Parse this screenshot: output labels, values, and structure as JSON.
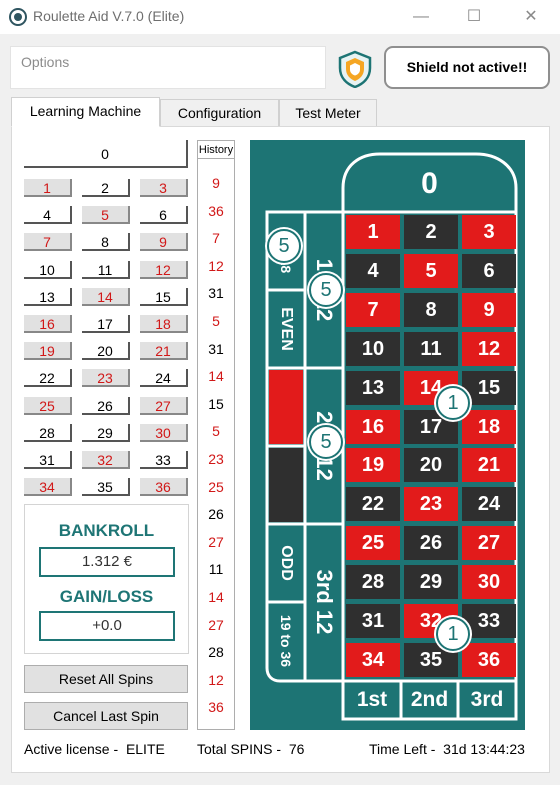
{
  "window": {
    "title": "Roulette Aid V.7.0 (Elite)",
    "minimize": "—",
    "maximize": "☐",
    "close": "✕"
  },
  "options": {
    "placeholder": "Options"
  },
  "shield": {
    "status": "Shield not active!!"
  },
  "tabs": [
    {
      "label": "Learning Machine",
      "active": true
    },
    {
      "label": "Configuration",
      "active": false
    },
    {
      "label": "Test Meter",
      "active": false
    }
  ],
  "number_grid": {
    "zero": "0",
    "rows": [
      [
        "1",
        "2",
        "3"
      ],
      [
        "4",
        "5",
        "6"
      ],
      [
        "7",
        "8",
        "9"
      ],
      [
        "10",
        "11",
        "12"
      ],
      [
        "13",
        "14",
        "15"
      ],
      [
        "16",
        "17",
        "18"
      ],
      [
        "19",
        "20",
        "21"
      ],
      [
        "22",
        "23",
        "24"
      ],
      [
        "25",
        "26",
        "27"
      ],
      [
        "28",
        "29",
        "30"
      ],
      [
        "31",
        "32",
        "33"
      ],
      [
        "34",
        "35",
        "36"
      ]
    ]
  },
  "bankroll": {
    "label": "BANKROLL",
    "value": "1.312 €",
    "gain_loss_label": "GAIN/LOSS",
    "gain_loss_value": "+0.0"
  },
  "buttons": {
    "reset_all": "Reset All Spins",
    "cancel_last": "Cancel Last Spin"
  },
  "history": {
    "title": "History",
    "spins": [
      "9",
      "36",
      "7",
      "12",
      "31",
      "5",
      "31",
      "14",
      "15",
      "5",
      "23",
      "25",
      "26",
      "27",
      "11",
      "14",
      "27",
      "28",
      "12",
      "36"
    ]
  },
  "board": {
    "zero": "0",
    "rows": [
      [
        "1",
        "2",
        "3"
      ],
      [
        "4",
        "5",
        "6"
      ],
      [
        "7",
        "8",
        "9"
      ],
      [
        "10",
        "11",
        "12"
      ],
      [
        "13",
        "14",
        "15"
      ],
      [
        "16",
        "17",
        "18"
      ],
      [
        "19",
        "20",
        "21"
      ],
      [
        "22",
        "23",
        "24"
      ],
      [
        "25",
        "26",
        "27"
      ],
      [
        "28",
        "29",
        "30"
      ],
      [
        "31",
        "32",
        "33"
      ],
      [
        "34",
        "35",
        "36"
      ]
    ],
    "dozens": [
      "1st 12",
      "2nd 12",
      "3rd 12"
    ],
    "outside": {
      "low": "1 to 18",
      "even": "EVEN",
      "odd": "ODD",
      "high": "19 to 36"
    },
    "columns": [
      "1st",
      "2nd",
      "3rd"
    ],
    "badges": [
      {
        "value": "5",
        "target": "1 to 18"
      },
      {
        "value": "5",
        "target": "1st 12"
      },
      {
        "value": "5",
        "target": "2nd 12"
      },
      {
        "value": "1",
        "target": "14-15 split"
      },
      {
        "value": "1",
        "target": "32-33 split"
      }
    ]
  },
  "colors": {
    "accent_teal": "#1d7474",
    "roulette_red": "#e21b1b",
    "roulette_black": "#2f2f2f",
    "number_red_text": "#d11818"
  },
  "footer": {
    "license_label": "Active license -",
    "license_value": "ELITE",
    "spins_label": "Total SPINS -",
    "spins_value": "76",
    "time_label": "Time Left -",
    "time_value": "31d 13:44:23"
  }
}
